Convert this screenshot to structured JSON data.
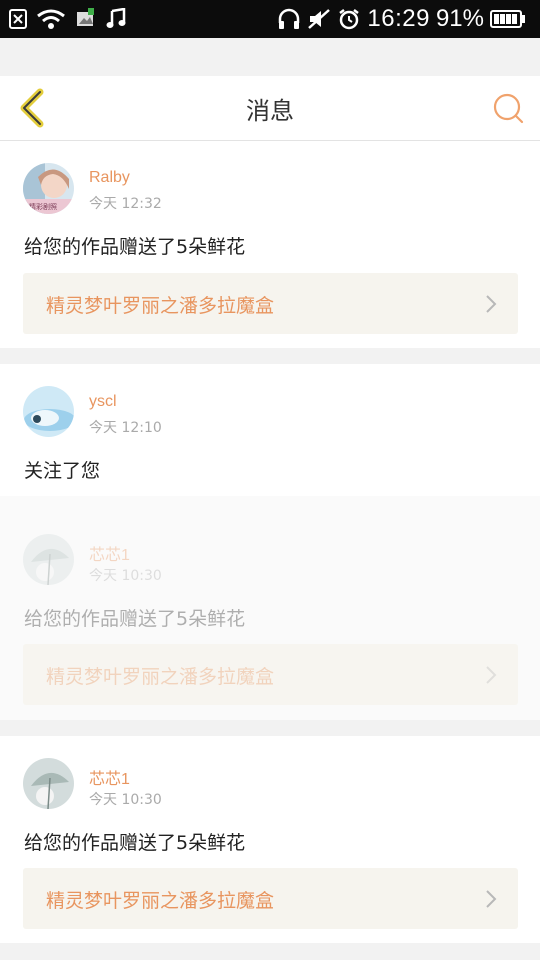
{
  "status_bar": {
    "time": "16:29",
    "battery": "91%"
  },
  "header": {
    "title": "消息"
  },
  "colors": {
    "accent": "#e8955f",
    "back_arrow": "#e3cd3b",
    "work_bg": "#f6f4ee"
  },
  "messages": [
    {
      "user": "Ralby",
      "time": "今天 12:32",
      "text": "给您的作品赠送了5朵鲜花",
      "work": "精灵梦叶罗丽之潘多拉魔盒",
      "avatar_text": "精彩剧照"
    },
    {
      "user": "yscl",
      "time": "今天 12:10",
      "text": "关注了您"
    },
    {
      "user": "芯芯1",
      "time": "今天 10:30",
      "text": "给您的作品赠送了5朵鲜花",
      "work": "精灵梦叶罗丽之潘多拉魔盒"
    },
    {
      "user": "芯芯1",
      "time": "今天 10:30",
      "text": "给您的作品赠送了5朵鲜花",
      "work": "精灵梦叶罗丽之潘多拉魔盒"
    }
  ]
}
